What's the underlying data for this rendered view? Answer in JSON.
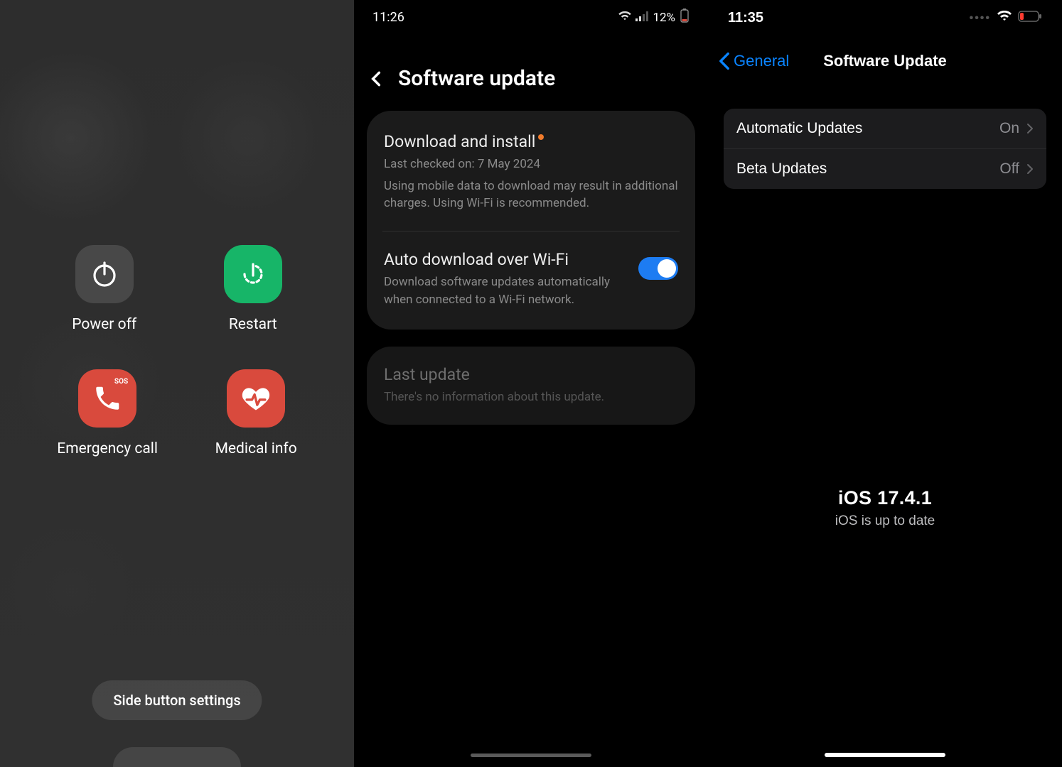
{
  "panel1": {
    "power_off": "Power off",
    "restart": "Restart",
    "emergency": "Emergency call",
    "medical": "Medical info",
    "sos": "SOS",
    "side_button": "Side button settings"
  },
  "panel2": {
    "time": "11:26",
    "battery_pct": "12%",
    "title": "Software update",
    "download": {
      "title": "Download and install",
      "checked": "Last checked on: 7 May 2024",
      "note": "Using mobile data to download may result in additional charges. Using Wi-Fi is recommended."
    },
    "auto": {
      "title": "Auto download over Wi-Fi",
      "desc": "Download software updates automatically when connected to a Wi-Fi network.",
      "on": true
    },
    "last": {
      "title": "Last update",
      "desc": "There's no information about this update."
    }
  },
  "panel3": {
    "time": "11:35",
    "back": "General",
    "title": "Software Update",
    "rows": [
      {
        "label": "Automatic Updates",
        "value": "On"
      },
      {
        "label": "Beta Updates",
        "value": "Off"
      }
    ],
    "version": "iOS 17.4.1",
    "status": "iOS is up to date"
  }
}
